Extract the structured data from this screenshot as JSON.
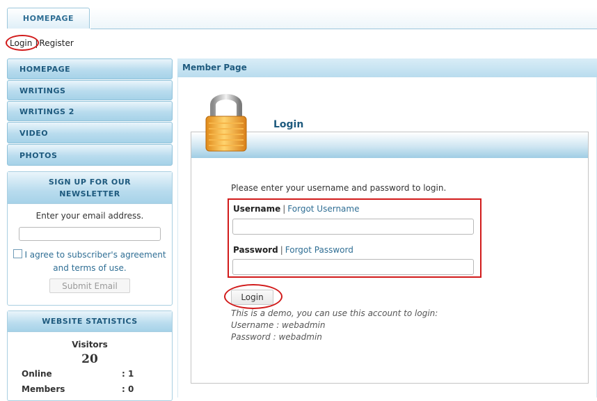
{
  "header": {
    "tab_label": "HOMEPAGE"
  },
  "auth": {
    "login_label": "Login",
    "separator": "|",
    "register_label": "Register"
  },
  "menu": {
    "items": [
      {
        "label": "HOMEPAGE"
      },
      {
        "label": "WRITINGS"
      },
      {
        "label": "WRITINGS 2"
      },
      {
        "label": "VIDEO"
      },
      {
        "label": "PHOTOS"
      }
    ]
  },
  "newsletter": {
    "title": "SIGN UP FOR OUR NEWSLETTER",
    "prompt": "Enter your email address.",
    "email_value": "",
    "agree_text": "I agree to subscriber's agreement and terms of use.",
    "submit_label": "Submit Email"
  },
  "stats": {
    "title": "WEBSITE STATISTICS",
    "visitors_label": "Visitors",
    "visitors_value": "20",
    "rows": [
      {
        "label": "Online",
        "value": ": 1"
      },
      {
        "label": "Members",
        "value": ": 0"
      }
    ]
  },
  "main": {
    "title": "Member Page",
    "login": {
      "heading": "Login",
      "intro": "Please enter your username and password to login.",
      "username_label": "Username",
      "username_sep": "|",
      "forgot_username": "Forgot Username",
      "username_value": "",
      "password_label": "Password",
      "password_sep": "|",
      "forgot_password": "Forgot Password",
      "password_value": "",
      "button_label": "Login",
      "demo_line1": "This is a demo, you can use this account to login:",
      "demo_line2": "Username : webadmin",
      "demo_line3": "Password : webadmin"
    }
  },
  "icons": {
    "lock": "padlock-icon",
    "checkbox": "checkbox-icon"
  },
  "colors": {
    "accent": "#2f6e94",
    "highlight": "#d11a1a",
    "menu_bg": "#b9dcee"
  }
}
